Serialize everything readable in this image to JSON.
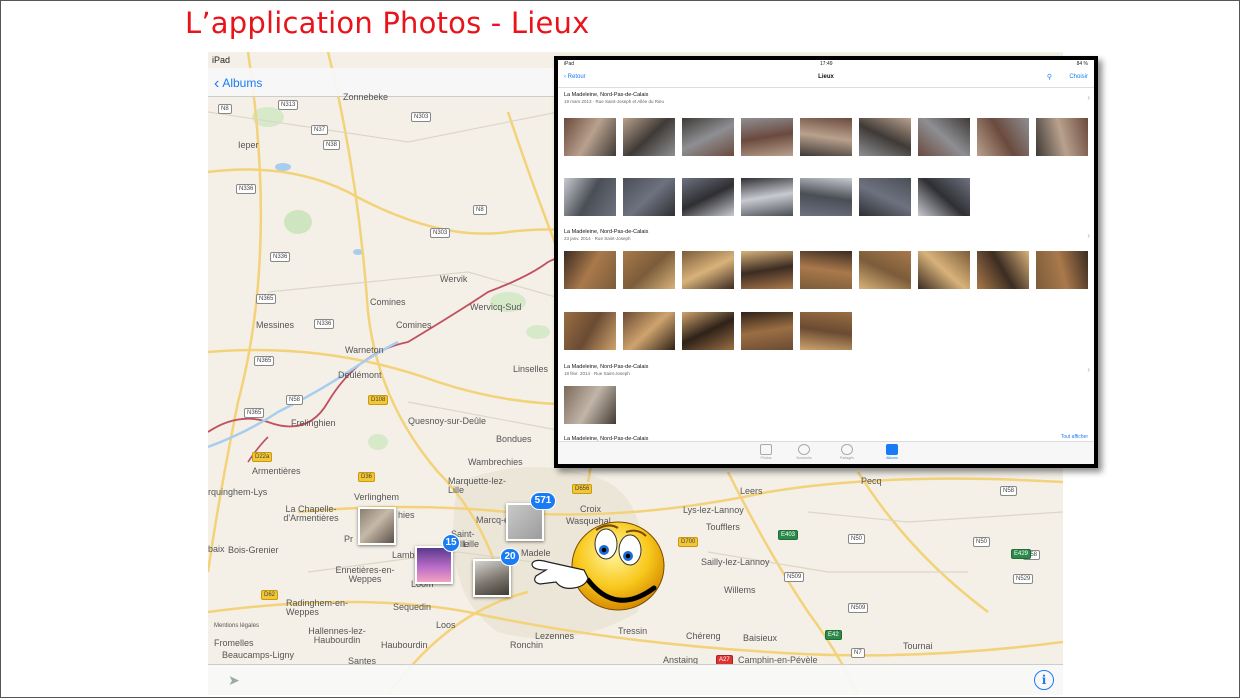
{
  "slide": {
    "title": "L’application Photos - Lieux"
  },
  "map_screen": {
    "status": {
      "device": "iPad"
    },
    "nav": {
      "back_label": "Albums"
    },
    "places": [
      {
        "name": "Zonnebeke"
      },
      {
        "name": "Ieper"
      },
      {
        "name": "Wervik"
      },
      {
        "name": "Wervicq-Sud"
      },
      {
        "name": "Comines"
      },
      {
        "name": "Comines"
      },
      {
        "name": "Messines"
      },
      {
        "name": "Warneton"
      },
      {
        "name": "Deûlémont"
      },
      {
        "name": "Frelinghien"
      },
      {
        "name": "Quesnoy-sur-Deûle"
      },
      {
        "name": "Linselles"
      },
      {
        "name": "Bondues"
      },
      {
        "name": "Armentières"
      },
      {
        "name": "Wambrechies"
      },
      {
        "name": "rquinghem-Lys"
      },
      {
        "name": "Verlinghem"
      },
      {
        "name": "Marquette-lez-Lille"
      },
      {
        "name": "La Chapelle-d'Armentières"
      },
      {
        "name": "Croix"
      },
      {
        "name": "Wasquehal"
      },
      {
        "name": "Lys-lez-Lannoy"
      },
      {
        "name": "Toufflers"
      },
      {
        "name": "Marcq-e"
      },
      {
        "name": "Saint-"
      },
      {
        "name": "Lille"
      },
      {
        "name": "Bois-Grenier"
      },
      {
        "name": "Lamb"
      },
      {
        "name": "Madele"
      },
      {
        "name": "Sailly-lez-Lannoy"
      },
      {
        "name": "Ennetières-en-Weppes"
      },
      {
        "name": "Loom"
      },
      {
        "name": "Willems"
      },
      {
        "name": "Radinghem-en-Weppes"
      },
      {
        "name": "Sequedin"
      },
      {
        "name": "Hallennes-lez-Haubourdin"
      },
      {
        "name": "Haubourdin"
      },
      {
        "name": "Loos"
      },
      {
        "name": "Lezennes"
      },
      {
        "name": "Tressin"
      },
      {
        "name": "Chéreng"
      },
      {
        "name": "Baisieux"
      },
      {
        "name": "Tournai"
      },
      {
        "name": "Fromelles"
      },
      {
        "name": "Beaucamps-Ligny"
      },
      {
        "name": "Ronchin"
      },
      {
        "name": "Santes"
      },
      {
        "name": "Anstaing"
      },
      {
        "name": "Camphin-en-Pévèle"
      },
      {
        "name": "baix"
      },
      {
        "name": "Pecq"
      },
      {
        "name": "Leers"
      },
      {
        "name": "hies"
      },
      {
        "name": "Pr"
      },
      {
        "name": "lle"
      },
      {
        "name": "Mentions légales"
      }
    ],
    "roads": [
      "N8",
      "N313",
      "N37",
      "N303",
      "N38",
      "N336",
      "N8",
      "N303",
      "N336",
      "N365",
      "N336",
      "N365",
      "N58",
      "N365",
      "D108",
      "D22a",
      "D36",
      "D656",
      "D700",
      "E403",
      "N50",
      "N58",
      "N50",
      "N58",
      "N509",
      "N509",
      "E429",
      "N529",
      "N7",
      "D62",
      "E42",
      "A27"
    ],
    "clusters": [
      {
        "count": "571"
      },
      {
        "count": "15"
      },
      {
        "count": "20"
      }
    ],
    "info_icon": "info-icon"
  },
  "places_screen": {
    "status": {
      "device": "iPad",
      "time": "17:49",
      "battery": "84 %"
    },
    "nav": {
      "back_label": "Retour",
      "title": "Lieux",
      "choose_label": "Choisir"
    },
    "sections": [
      {
        "title": "La Madeleine, Nord-Pas-de-Calais",
        "subtitle": "19 mars 2013 · Rue Saint-Joseph et Allée du Rieu"
      },
      {
        "title": "La Madeleine, Nord-Pas-de-Calais",
        "subtitle": "23 janv. 2014 · Rue Saint-Joseph"
      },
      {
        "title": "La Madeleine, Nord-Pas-de-Calais",
        "subtitle": "18 févr. 2014 · Rue Saint-Joseph"
      },
      {
        "title": "La Madeleine, Nord-Pas-de-Calais",
        "subtitle": ""
      }
    ],
    "show_all": "Tout afficher",
    "tabs": [
      {
        "label": "Photos"
      },
      {
        "label": "Souvenirs"
      },
      {
        "label": "Partagés"
      },
      {
        "label": "Albums"
      }
    ]
  },
  "colors": {
    "accent": "#1a7cf5",
    "title_red": "#e8141b",
    "map_bg": "#f5f1e8",
    "border_red": "#c15060"
  }
}
